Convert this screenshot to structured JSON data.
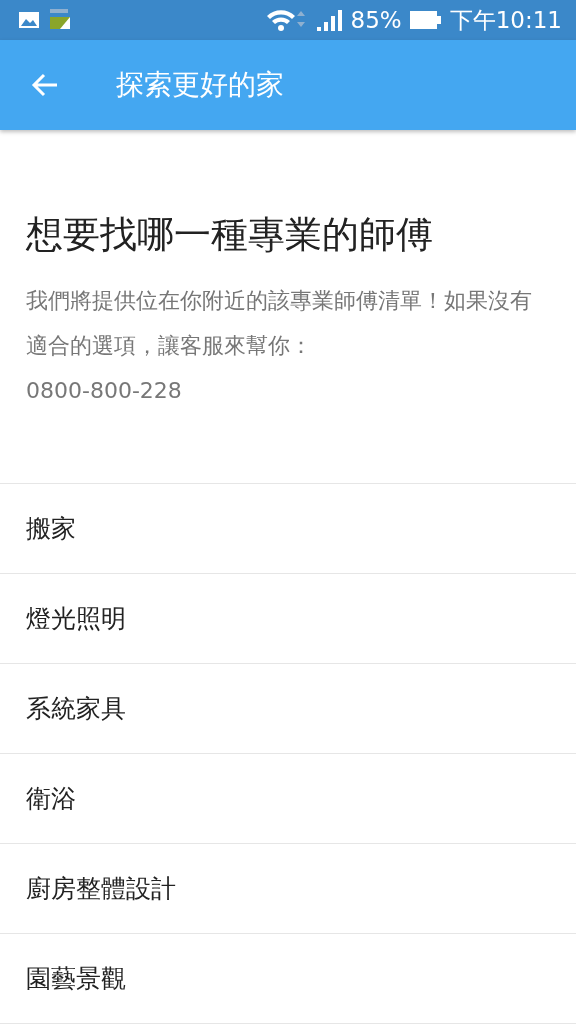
{
  "status_bar": {
    "battery": "85%",
    "time": "下午10:11"
  },
  "app_bar": {
    "title": "探索更好的家"
  },
  "heading": "想要找哪一種專業的師傅",
  "description": "我們將提供位在你附近的該專業師傅清單！如果沒有適合的選項，讓客服來幫你：",
  "phone": "0800-800-228",
  "categories": [
    {
      "label": "搬家"
    },
    {
      "label": "燈光照明"
    },
    {
      "label": "系統家具"
    },
    {
      "label": "衛浴"
    },
    {
      "label": "廚房整體設計"
    },
    {
      "label": "園藝景觀"
    }
  ]
}
